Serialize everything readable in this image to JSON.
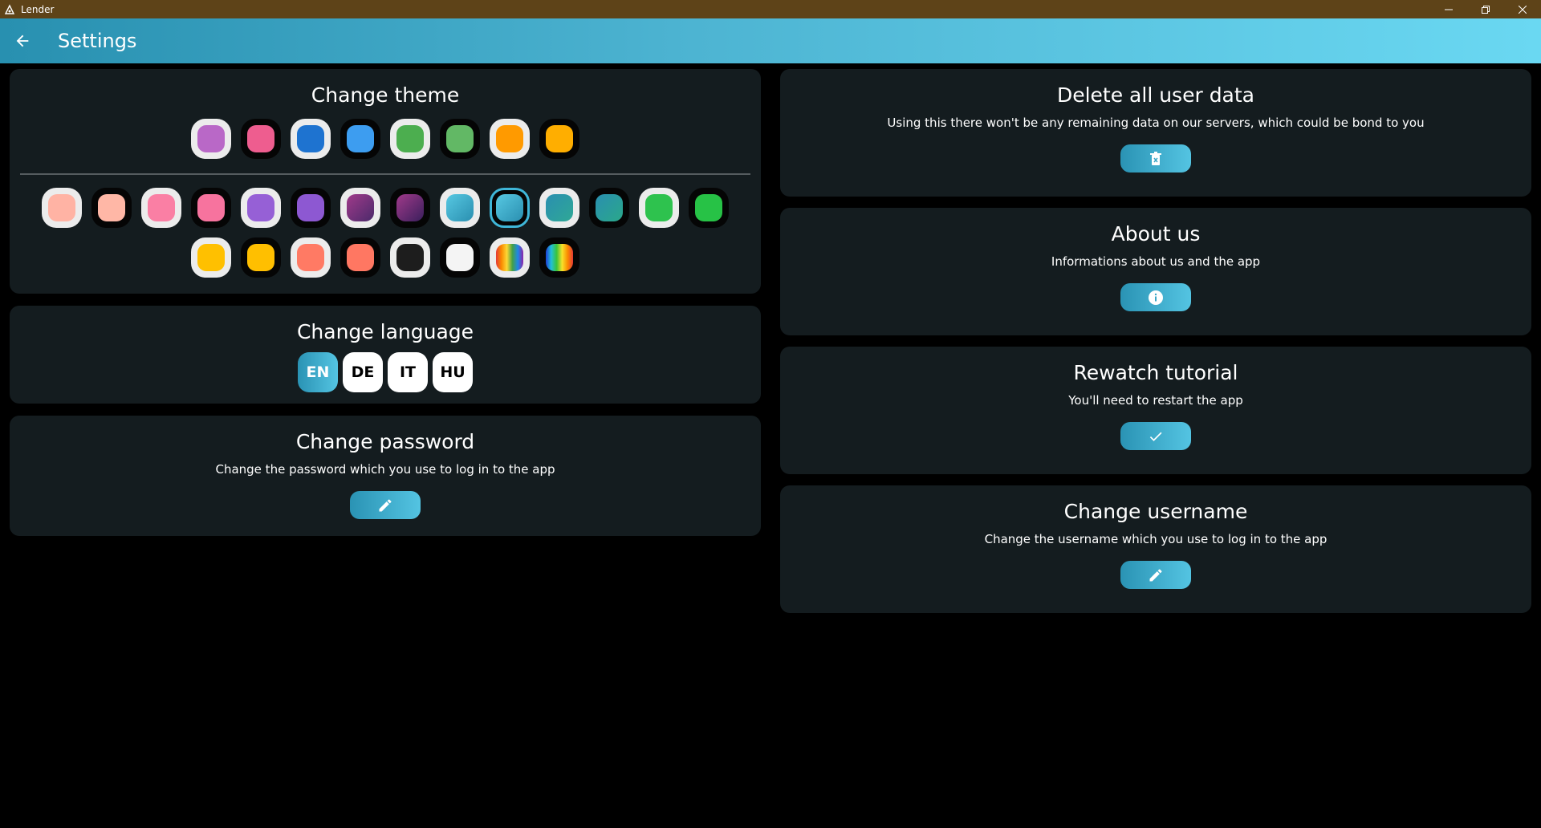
{
  "window": {
    "title": "Lender",
    "controls": [
      "minimize",
      "maximize",
      "close"
    ]
  },
  "appbar": {
    "title": "Settings",
    "back_icon": "arrow-left-icon"
  },
  "theme": {
    "title": "Change theme",
    "top_row": [
      {
        "bg": "light",
        "color": "#b968c7"
      },
      {
        "bg": "dark",
        "color": "#ee5d8f"
      },
      {
        "bg": "light",
        "color": "#1e73d0"
      },
      {
        "bg": "dark",
        "color": "#3d9df0"
      },
      {
        "bg": "light",
        "color": "#4cae4f"
      },
      {
        "bg": "dark",
        "color": "#62b865"
      },
      {
        "bg": "light",
        "color": "#ff9a00"
      },
      {
        "bg": "dark",
        "color": "#ffae00"
      }
    ],
    "row2": [
      {
        "bg": "light",
        "color": "#ffb3a4"
      },
      {
        "bg": "dark",
        "color": "#ffb7a6"
      },
      {
        "bg": "light",
        "color": "#fa7fa4"
      },
      {
        "bg": "dark",
        "color": "#f7739e"
      },
      {
        "bg": "light",
        "color": "#9660d6"
      },
      {
        "bg": "dark",
        "color": "#8d58d2"
      },
      {
        "bg": "light",
        "gradient": "linear-gradient(135deg,#a03a8a,#4b2a6b)"
      },
      {
        "bg": "dark",
        "gradient": "linear-gradient(135deg,#a03a8a,#3a1f5c)"
      },
      {
        "bg": "light",
        "gradient": "linear-gradient(135deg,#57c8e2,#2a8fb0)"
      },
      {
        "bg": "selected",
        "gradient": "linear-gradient(135deg,#57c8e2,#2a8fb0)"
      },
      {
        "bg": "light",
        "gradient": "linear-gradient(135deg,#2a8fb0,#2fa896)"
      },
      {
        "bg": "dark",
        "gradient": "linear-gradient(135deg,#2a8fb0,#2aa88a)"
      },
      {
        "bg": "light",
        "color": "#2ec24e"
      },
      {
        "bg": "dark",
        "color": "#27c246"
      }
    ],
    "row3": [
      {
        "bg": "light",
        "color": "#ffc000"
      },
      {
        "bg": "dark",
        "color": "#ffbf00"
      },
      {
        "bg": "light",
        "color": "#ff7a64"
      },
      {
        "bg": "dark",
        "color": "#ff7762"
      },
      {
        "bg": "light",
        "color": "#1d1d1d"
      },
      {
        "bg": "dark",
        "color": "#f4f4f4"
      },
      {
        "bg": "light",
        "gradient": "linear-gradient(90deg,#e53935,#fb8c00,#fdd835,#43a047,#1e88e5,#8e24aa)"
      },
      {
        "bg": "dark",
        "gradient": "linear-gradient(90deg,#1e3fd8,#22c0d8,#3ac43a,#f7e12a,#fb8c00,#e53935)"
      }
    ]
  },
  "language": {
    "title": "Change language",
    "options": [
      "EN",
      "DE",
      "IT",
      "HU"
    ],
    "selected": "EN"
  },
  "password": {
    "title": "Change password",
    "description": "Change the password which you use to log in to the app",
    "button_icon": "pencil-icon"
  },
  "delete_data": {
    "title": "Delete all user data",
    "description": "Using this there won't be any remaining data on our servers, which could be bond to you",
    "button_icon": "trash-icon"
  },
  "about": {
    "title": "About us",
    "description": "Informations about us and the app",
    "button_icon": "info-icon"
  },
  "tutorial": {
    "title": "Rewatch tutorial",
    "description": "You'll need to restart the app",
    "button_icon": "check-icon"
  },
  "username": {
    "title": "Change username",
    "description": "Change the username which you use to log in to the app",
    "button_icon": "pencil-icon"
  },
  "colors": {
    "titlebar": "#5e4318",
    "card": "#141c1f",
    "accent": "#3fb6d8"
  }
}
